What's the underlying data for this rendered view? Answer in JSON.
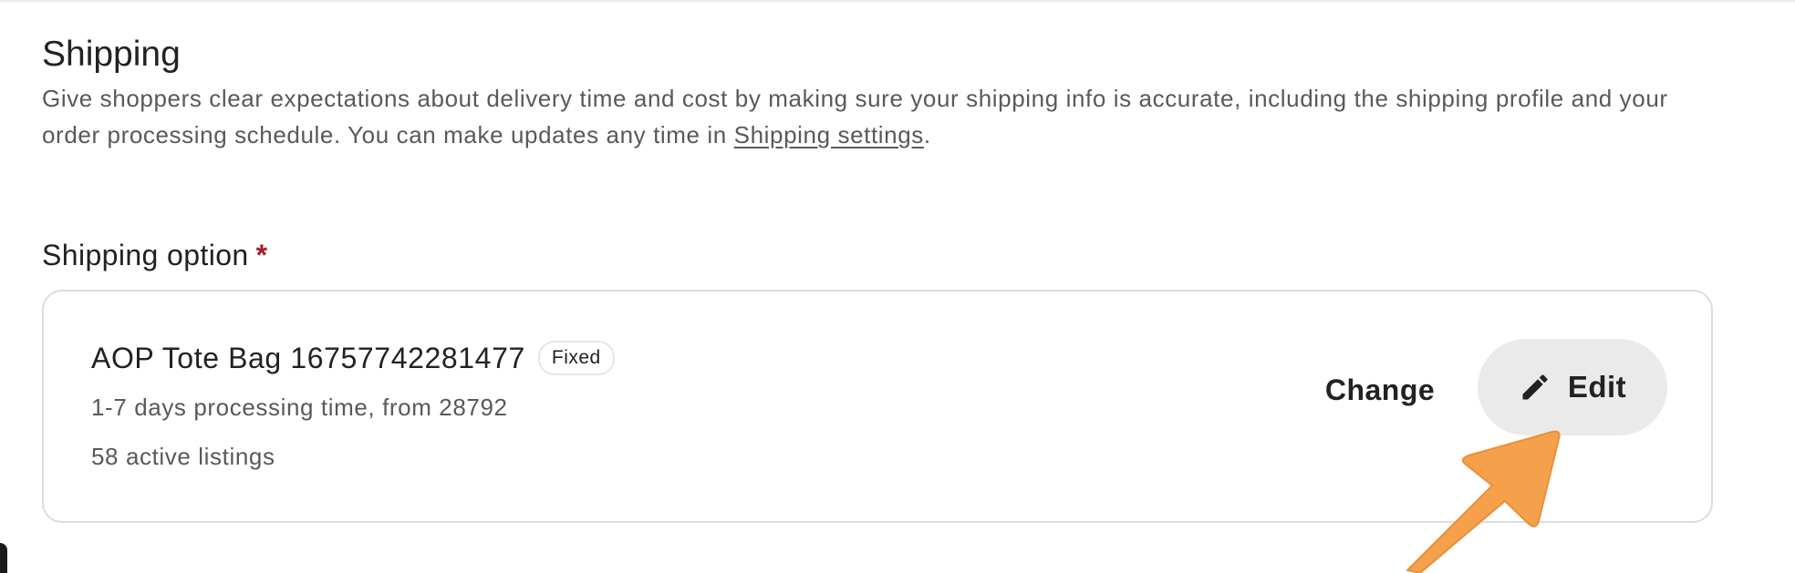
{
  "shipping": {
    "title": "Shipping",
    "description": "Give shoppers clear expectations about delivery time and cost by making sure your shipping info is accurate, including the shipping profile and your order processing schedule. You can make updates any time in ",
    "settings_link": "Shipping settings",
    "description_end": "."
  },
  "shipping_option": {
    "label": "Shipping option",
    "required_mark": "*",
    "profile": {
      "name": "AOP Tote Bag 16757742281477",
      "badge": "Fixed",
      "processing": "1-7 days processing time, from 28792",
      "listings": "58 active listings"
    },
    "change_label": "Change",
    "edit_label": "Edit",
    "edit_icon": "pencil-icon"
  },
  "colors": {
    "required": "#a61a2e",
    "edit_button_bg": "#eaeaea",
    "arrow": "#f5a04a",
    "card_border": "#dcdcdc"
  }
}
